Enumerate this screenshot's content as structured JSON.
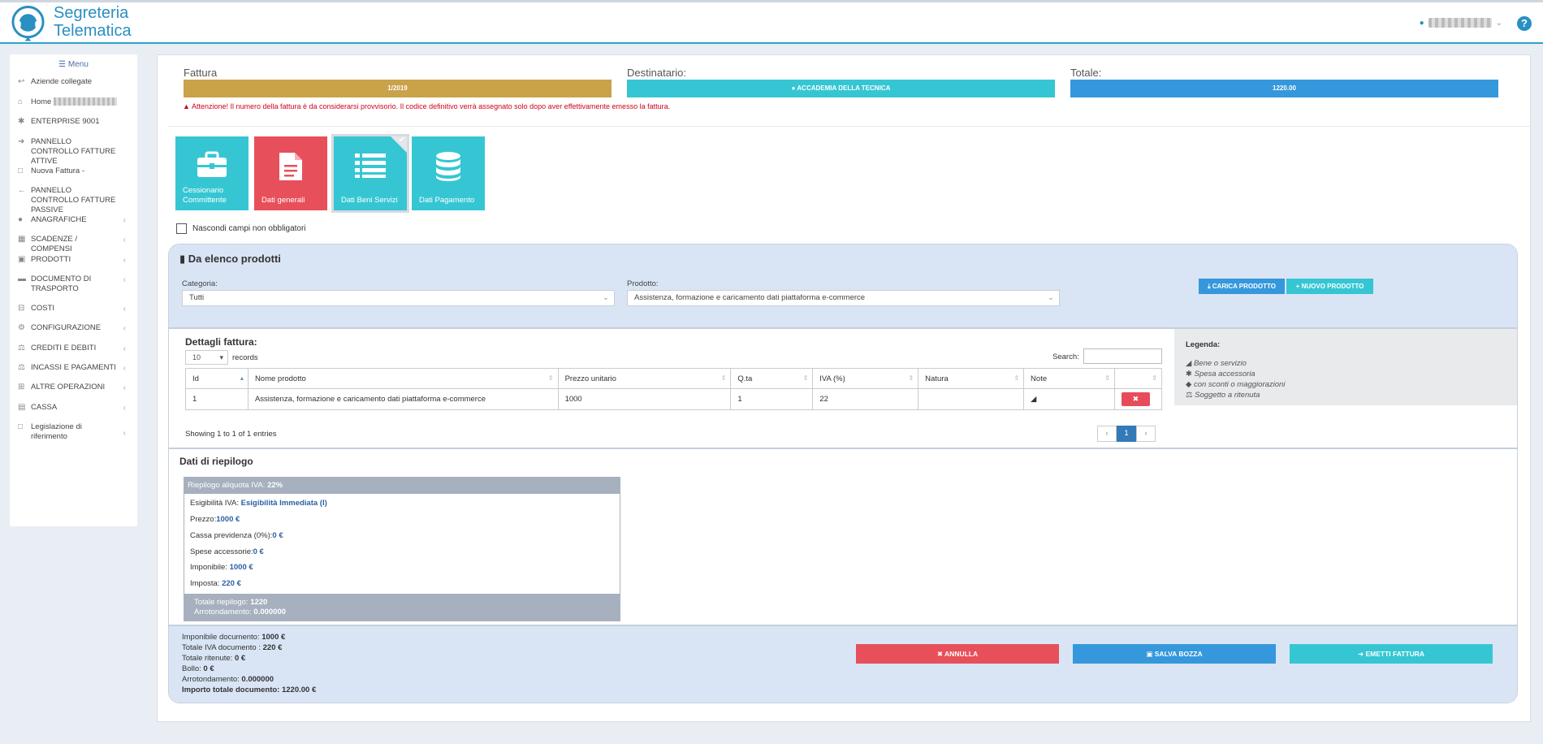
{
  "header": {
    "brand_line1": "Segreteria",
    "brand_line2": "Telematica",
    "help": "?"
  },
  "sidebar": {
    "menu_title": "Menu",
    "items": [
      {
        "label": "Aziende collegate"
      },
      {
        "label": "Home"
      },
      {
        "label": "ENTERPRISE 9001"
      },
      {
        "label": "PANNELLO CONTROLLO FATTURE ATTIVE"
      },
      {
        "label": "Nuova Fattura -"
      },
      {
        "label": "PANNELLO CONTROLLO FATTURE PASSIVE"
      },
      {
        "label": "ANAGRAFICHE"
      },
      {
        "label": "SCADENZE / COMPENSI"
      },
      {
        "label": "PRODOTTI"
      },
      {
        "label": "DOCUMENTO DI TRASPORTO"
      },
      {
        "label": "COSTI"
      },
      {
        "label": "CONFIGURAZIONE"
      },
      {
        "label": "CREDITI E DEBITI"
      },
      {
        "label": "INCASSI E PAGAMENTI"
      },
      {
        "label": "ALTRE OPERAZIONI"
      },
      {
        "label": "CASSA"
      },
      {
        "label": "Legislazione di riferimento"
      }
    ]
  },
  "summary": {
    "fattura_label": "Fattura",
    "fattura_value": "1/2019",
    "destinatario_label": "Destinatario:",
    "destinatario_value": "ACCADEMIA DELLA TECNICA",
    "totale_label": "Totale:",
    "totale_value": "1220.00",
    "warning": "Attenzione! Il numero della fattura è da considerarsi provvisorio. Il codice definitivo verrà assegnato solo dopo aver effettivamente emesso la fattura.",
    "colors": {
      "fattura": "#c9a24a",
      "destinatario": "#36c6d3",
      "totale": "#3598dc"
    }
  },
  "tiles": [
    {
      "label": "Cessionario Committente",
      "color": "#36c6d3",
      "icon": "briefcase-icon"
    },
    {
      "label": "Dati generali",
      "color": "#e7505a",
      "icon": "document-icon"
    },
    {
      "label": "Dati Beni Servizi",
      "color": "#36c6d3",
      "icon": "list-icon",
      "selected": true
    },
    {
      "label": "Dati Pagamento",
      "color": "#36c6d3",
      "icon": "database-icon"
    }
  ],
  "hide_optional_label": "Nascondi campi non obbligatori",
  "products": {
    "title": "Da elenco prodotti",
    "categoria_label": "Categoria:",
    "categoria_value": "Tutti",
    "prodotto_label": "Prodotto:",
    "prodotto_value": "Assistenza, formazione e caricamento dati piattaforma e-commerce",
    "carica_label": "CARICA PRODOTTO",
    "nuovo_label": "NUOVO PRODOTTO"
  },
  "details": {
    "title": "Dettagli fattura:",
    "page_length": "10",
    "records_label": "records",
    "search_label": "Search:",
    "columns": [
      "Id",
      "Nome prodotto",
      "Prezzo unitario",
      "Q.ta",
      "IVA (%)",
      "Natura",
      "Note",
      ""
    ],
    "rows": [
      {
        "id": "1",
        "name": "Assistenza, formazione e caricamento dati piattaforma e-commerce",
        "price": "1000",
        "qty": "1",
        "iva": "22",
        "natura": "",
        "note_icon": "box-icon",
        "delete": "✖"
      }
    ],
    "showing": "Showing 1 to 1 of 1 entries",
    "pager": {
      "prev": "‹",
      "current": "1",
      "next": "›"
    }
  },
  "legend": {
    "title": "Legenda:",
    "items": [
      "Bene o servizio",
      "Spesa accessoria",
      "con sconti o maggiorazioni",
      "Soggetto a ritenuta"
    ]
  },
  "riepilogo": {
    "title": "Dati di riepilogo",
    "head_label": "Riepilogo aliquota IVA:",
    "head_value": "22%",
    "esigibilita_label": "Esigibilità IVA:",
    "esigibilita_value": "Esigibilità Immediata (I)",
    "prezzo_label": "Prezzo:",
    "prezzo_value": "1000 €",
    "cassa_label": "Cassa previdenza (0%):",
    "cassa_value": "0 €",
    "spese_label": "Spese accessorie:",
    "spese_value": "0 €",
    "imponibile_label": "Imponibile:",
    "imponibile_value": "1000 €",
    "imposta_label": "Imposta:",
    "imposta_value": "220 €",
    "totale_label": "Totale riepilogo:",
    "totale_value": "1220",
    "arrotondamento_label": "Arrotondamento:",
    "arrotondamento_value": "0.000000"
  },
  "totals": {
    "imponibile_label": "Imponibile documento:",
    "imponibile_value": "1000 €",
    "iva_label": "Totale IVA documento :",
    "iva_value": "220 €",
    "ritenute_label": "Totale ritenute:",
    "ritenute_value": "0 €",
    "bollo_label": "Bollo:",
    "bollo_value": "0 €",
    "arrotondamento_label": "Arrotondamento:",
    "arrotondamento_value": "0.000000",
    "importo_label": "Importo totale documento:",
    "importo_value": "1220.00 €"
  },
  "actions": {
    "annulla": "ANNULLA",
    "salva": "SALVA BOZZA",
    "emetti": "EMETTI FATTURA"
  }
}
